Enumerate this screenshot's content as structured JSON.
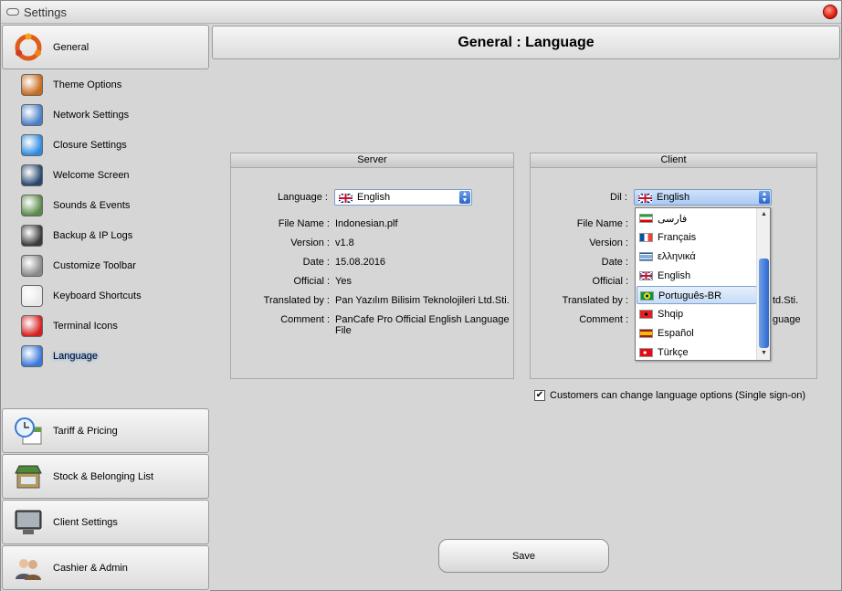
{
  "window": {
    "title": "Settings"
  },
  "sidebar": {
    "general": "General",
    "items": [
      {
        "label": "Theme Options",
        "icon": "theme-icon",
        "color": "#c86a1e"
      },
      {
        "label": "Network Settings",
        "icon": "network-icon",
        "color": "#4a7fc8"
      },
      {
        "label": "Closure Settings",
        "icon": "info-icon",
        "color": "#2f8ae0"
      },
      {
        "label": "Welcome Screen",
        "icon": "megaphone-icon",
        "color": "#27476e"
      },
      {
        "label": "Sounds & Events",
        "icon": "speaker-icon",
        "color": "#5a8a4a"
      },
      {
        "label": "Backup & IP Logs",
        "icon": "backup-icon",
        "color": "#3a3a3a"
      },
      {
        "label": "Customize Toolbar",
        "icon": "wrench-icon",
        "color": "#8a8a8a"
      },
      {
        "label": "Keyboard Shortcuts",
        "icon": "keyboard-icon",
        "color": "#e8e8e8"
      },
      {
        "label": "Terminal Icons",
        "icon": "ico-icon",
        "color": "#d42020"
      },
      {
        "label": "Language",
        "icon": "translate-icon",
        "color": "#3a78d8"
      }
    ],
    "categories": [
      {
        "label": "Tariff & Pricing",
        "icon": "clock-calendar-icon"
      },
      {
        "label": "Stock & Belonging List",
        "icon": "shop-icon"
      },
      {
        "label": "Client Settings",
        "icon": "monitor-icon"
      },
      {
        "label": "Cashier & Admin",
        "icon": "users-icon"
      }
    ]
  },
  "header": {
    "title": "General : Language"
  },
  "server": {
    "title": "Server",
    "language_label": "Language :",
    "language_value": "English",
    "rows": [
      {
        "k": "File Name :",
        "v": "Indonesian.plf"
      },
      {
        "k": "Version :",
        "v": "v1.8"
      },
      {
        "k": "Date :",
        "v": "15.08.2016"
      },
      {
        "k": "Official :",
        "v": "Yes"
      },
      {
        "k": "Translated by :",
        "v": "Pan Yazılım Bilisim Teknolojileri Ltd.Sti."
      },
      {
        "k": "Comment :",
        "v": "PanCafe Pro Official English Language",
        "v2": "File"
      }
    ]
  },
  "client": {
    "title": "Client",
    "language_label": "Dil :",
    "language_value": "English",
    "rows": [
      {
        "k": "File Name :"
      },
      {
        "k": "Version :"
      },
      {
        "k": "Date :"
      },
      {
        "k": "Official :"
      },
      {
        "k": "Translated by :",
        "v": "td.Sti."
      },
      {
        "k": "Comment :",
        "v": "guage"
      }
    ]
  },
  "dropdown": {
    "selected": "Português-BR",
    "options": [
      {
        "label": "فارسی",
        "flag": "iran"
      },
      {
        "label": "Français",
        "flag": "france"
      },
      {
        "label": "ελληνικά",
        "flag": "greece"
      },
      {
        "label": "English",
        "flag": "uk"
      },
      {
        "label": "Português-BR",
        "flag": "brazil"
      },
      {
        "label": "Shqip",
        "flag": "albania"
      },
      {
        "label": "Español",
        "flag": "spain"
      },
      {
        "label": "Türkçe",
        "flag": "turkey"
      }
    ]
  },
  "options": {
    "single_signon_label": "Customers can change language options (Single sign-on)",
    "single_signon_checked": true
  },
  "footer": {
    "save_label": "Save"
  }
}
